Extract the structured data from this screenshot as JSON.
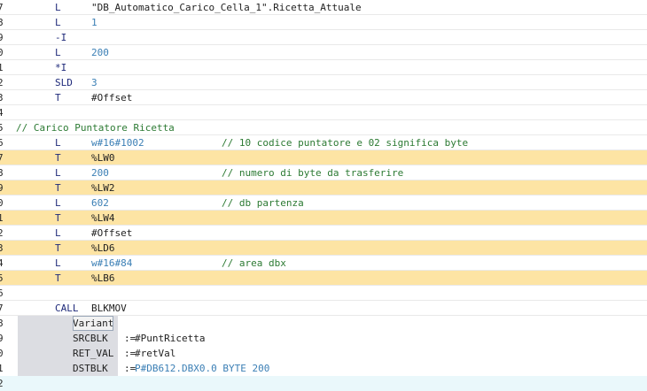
{
  "editor": {
    "lines": [
      {
        "ln": "7",
        "op": "L",
        "arg": "\"DB_Automatico_Carico_Cella_1\".Ricetta_Attuale",
        "arg_type": "dark"
      },
      {
        "ln": "8",
        "op": "L",
        "arg": "1",
        "arg_type": "num"
      },
      {
        "ln": "9",
        "op": "-I",
        "arg": "",
        "arg_type": "dark"
      },
      {
        "ln": "0",
        "op": "L",
        "arg": "200",
        "arg_type": "num"
      },
      {
        "ln": "1",
        "op": "*I",
        "arg": "",
        "arg_type": "dark"
      },
      {
        "ln": "2",
        "op": "SLD",
        "arg": "3",
        "arg_type": "num"
      },
      {
        "ln": "3",
        "op": "T",
        "arg": "#Offset",
        "arg_type": "dark"
      },
      {
        "ln": "4",
        "op": "",
        "arg": "",
        "arg_type": "dark"
      },
      {
        "ln": "5",
        "comment_full": "// Carico Puntatore Ricetta"
      },
      {
        "ln": "6",
        "op": "L",
        "arg": "w#16#1002",
        "arg_type": "num",
        "comment": "// 10 codice puntatore e 02 significa byte"
      },
      {
        "ln": "7",
        "op": "T",
        "arg": "%LW0",
        "arg_type": "dark",
        "hl": true
      },
      {
        "ln": "8",
        "op": "L",
        "arg": "200",
        "arg_type": "num",
        "comment": "// numero di byte da trasferire"
      },
      {
        "ln": "9",
        "op": "T",
        "arg": "%LW2",
        "arg_type": "dark",
        "hl": true
      },
      {
        "ln": "0",
        "op": "L",
        "arg": "602",
        "arg_type": "num",
        "comment": "// db partenza"
      },
      {
        "ln": "1",
        "op": "T",
        "arg": "%LW4",
        "arg_type": "dark",
        "hl": true
      },
      {
        "ln": "2",
        "op": "L",
        "arg": "#Offset",
        "arg_type": "dark"
      },
      {
        "ln": "3",
        "op": "T",
        "arg": "%LD6",
        "arg_type": "dark",
        "hl": true
      },
      {
        "ln": "4",
        "op": "L",
        "arg": "w#16#84",
        "arg_type": "num",
        "comment": "// area dbx"
      },
      {
        "ln": "5",
        "op": "T",
        "arg": "%LB6",
        "arg_type": "dark",
        "hl": true
      },
      {
        "ln": "6",
        "op": "",
        "arg": "",
        "arg_type": "dark"
      },
      {
        "ln": "7",
        "op": "CALL",
        "arg": "BLKMOV",
        "arg_type": "dark"
      }
    ],
    "params": [
      {
        "ln": "8",
        "name": "Variant",
        "sep": "",
        "value": "",
        "value_num": ""
      },
      {
        "ln": "9",
        "name": "SRCBLK",
        "sep": ":=",
        "value": "#PuntRicetta",
        "value_num": ""
      },
      {
        "ln": "0",
        "name": "RET_VAL",
        "sep": ":=",
        "value": "#retVal",
        "value_num": ""
      },
      {
        "ln": "1",
        "name": "DSTBLK",
        "sep": ":=",
        "value": "",
        "value_num": "P#DB612.DBX0.0 BYTE 200"
      }
    ],
    "last_line_number": "2"
  }
}
